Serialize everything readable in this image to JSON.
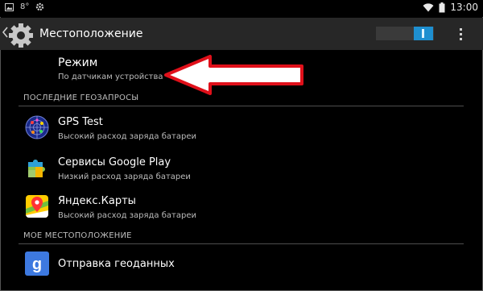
{
  "status_bar": {
    "temperature": "8°",
    "time": "13:00"
  },
  "action_bar": {
    "title": "Местоположение"
  },
  "mode": {
    "title": "Режим",
    "subtitle": "По датчикам устройства"
  },
  "recent_requests": {
    "header": "ПОСЛЕДНИЕ ГЕОЗАПРОСЫ",
    "items": [
      {
        "title": "GPS Test",
        "subtitle": "Высокий расход заряда батареи",
        "icon": "gps-test-icon"
      },
      {
        "title": "Сервисы Google Play",
        "subtitle": "Низкий расход заряда батареи",
        "icon": "google-play-services-icon"
      },
      {
        "title": "Яндекс.Карты",
        "subtitle": "Высокий расход заряда батареи",
        "icon": "yandex-maps-icon"
      }
    ]
  },
  "my_location": {
    "header": "МОЕ МЕСТОПОЛОЖЕНИЕ",
    "items": [
      {
        "title": "Отправка геоданных",
        "icon": "google-icon"
      }
    ]
  },
  "colors": {
    "accent": "#1e8fd0",
    "actionbar": "#272727",
    "background": "#000000",
    "annotation_arrow": "#e0101a"
  }
}
